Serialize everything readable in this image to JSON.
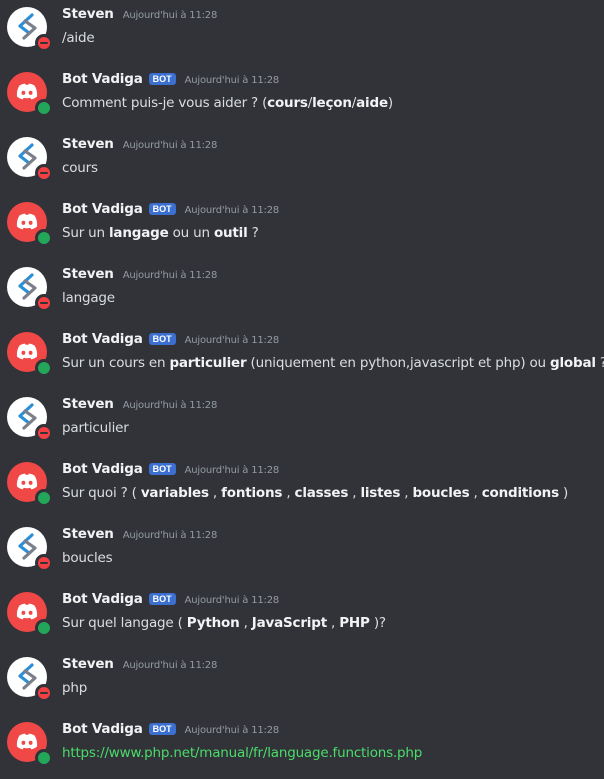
{
  "messages": [
    {
      "author": "Steven",
      "is_bot": false,
      "status": "dnd",
      "time": "Aujourd'hui à 11:28",
      "segments": [
        {
          "t": "/aide"
        }
      ]
    },
    {
      "author": "Bot Vadiga",
      "is_bot": true,
      "bot_tag": "BOT",
      "status": "online",
      "time": "Aujourd'hui à 11:28",
      "segments": [
        {
          "t": "Comment puis-je vous aider ? ("
        },
        {
          "t": "cours",
          "b": true
        },
        {
          "t": "/"
        },
        {
          "t": "leçon",
          "b": true
        },
        {
          "t": "/"
        },
        {
          "t": "aide",
          "b": true
        },
        {
          "t": ")"
        }
      ]
    },
    {
      "author": "Steven",
      "is_bot": false,
      "status": "dnd",
      "time": "Aujourd'hui à 11:28",
      "segments": [
        {
          "t": "cours"
        }
      ]
    },
    {
      "author": "Bot Vadiga",
      "is_bot": true,
      "bot_tag": "BOT",
      "status": "online",
      "time": "Aujourd'hui à 11:28",
      "segments": [
        {
          "t": "Sur un "
        },
        {
          "t": "langage",
          "b": true
        },
        {
          "t": " ou un "
        },
        {
          "t": "outil",
          "b": true
        },
        {
          "t": " ?"
        }
      ]
    },
    {
      "author": "Steven",
      "is_bot": false,
      "status": "dnd",
      "time": "Aujourd'hui à 11:28",
      "segments": [
        {
          "t": "langage"
        }
      ]
    },
    {
      "author": "Bot Vadiga",
      "is_bot": true,
      "bot_tag": "BOT",
      "status": "online",
      "time": "Aujourd'hui à 11:28",
      "segments": [
        {
          "t": "Sur un cours en "
        },
        {
          "t": "particulier",
          "b": true
        },
        {
          "t": " (uniquement en python,javascript et php) ou "
        },
        {
          "t": "global",
          "b": true
        },
        {
          "t": " ?"
        }
      ]
    },
    {
      "author": "Steven",
      "is_bot": false,
      "status": "dnd",
      "time": "Aujourd'hui à 11:28",
      "segments": [
        {
          "t": "particulier"
        }
      ]
    },
    {
      "author": "Bot Vadiga",
      "is_bot": true,
      "bot_tag": "BOT",
      "status": "online",
      "time": "Aujourd'hui à 11:28",
      "segments": [
        {
          "t": "Sur quoi ? ( "
        },
        {
          "t": "variables",
          "b": true
        },
        {
          "t": " , "
        },
        {
          "t": "fontions",
          "b": true
        },
        {
          "t": " , "
        },
        {
          "t": "classes",
          "b": true
        },
        {
          "t": " , "
        },
        {
          "t": "listes",
          "b": true
        },
        {
          "t": " , "
        },
        {
          "t": "boucles",
          "b": true
        },
        {
          "t": " , "
        },
        {
          "t": "conditions",
          "b": true
        },
        {
          "t": " )"
        }
      ]
    },
    {
      "author": "Steven",
      "is_bot": false,
      "status": "dnd",
      "time": "Aujourd'hui à 11:28",
      "segments": [
        {
          "t": "boucles"
        }
      ]
    },
    {
      "author": "Bot Vadiga",
      "is_bot": true,
      "bot_tag": "BOT",
      "status": "online",
      "time": "Aujourd'hui à 11:28",
      "segments": [
        {
          "t": "Sur quel langage ( "
        },
        {
          "t": "Python",
          "b": true
        },
        {
          "t": " , "
        },
        {
          "t": "JavaScript",
          "b": true
        },
        {
          "t": " , "
        },
        {
          "t": "PHP",
          "b": true
        },
        {
          "t": " )?"
        }
      ]
    },
    {
      "author": "Steven",
      "is_bot": false,
      "status": "dnd",
      "time": "Aujourd'hui à 11:28",
      "segments": [
        {
          "t": "php"
        }
      ]
    },
    {
      "author": "Bot Vadiga",
      "is_bot": true,
      "bot_tag": "BOT",
      "status": "online",
      "time": "Aujourd'hui à 11:28",
      "segments": [
        {
          "t": "https://www.php.net/manual/fr/language.functions.php",
          "link": true
        }
      ]
    }
  ],
  "colors": {
    "background": "#313338",
    "username": "#f2f3f5",
    "text": "#dbdee1",
    "timestamp": "#949ba4",
    "bot_tag": "#3b6fd0",
    "link": "#4bdc6a",
    "status_online": "#23a55a",
    "status_dnd": "#f23f43",
    "bot_avatar": "#f04747"
  },
  "icons": {
    "steven_avatar": "arrow-logo-icon",
    "bot_avatar": "discord-logo-icon"
  }
}
